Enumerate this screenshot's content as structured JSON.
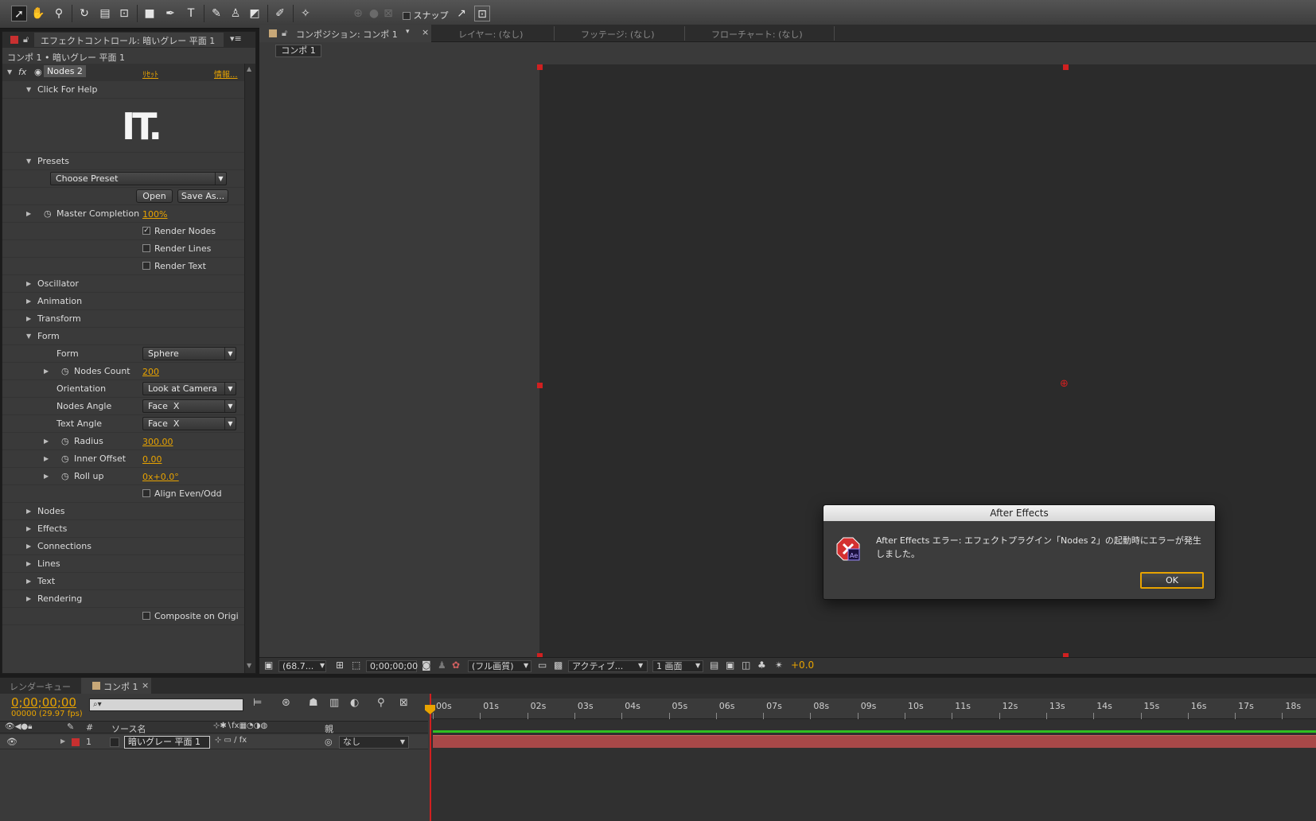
{
  "toolbar": {
    "snap_label": "スナップ"
  },
  "effect_panel": {
    "tab_label": "エフェクトコントロール: 暗いグレー 平面 1",
    "breadcrumb": "コンポ 1 • 暗いグレー 平面 1",
    "effect_name": "Nodes 2",
    "reset_label": "ﾘｾｯﾄ",
    "about_label": "情報...",
    "help_label": "Click For Help",
    "logo_text": "IT.",
    "presets_label": "Presets",
    "preset_dropdown": "Choose Preset",
    "open_button": "Open",
    "save_as_button": "Save As...",
    "master_completion_label": "Master Completion",
    "master_completion_value": "100%",
    "render_nodes": {
      "label": "Render Nodes",
      "checked": true
    },
    "render_lines": {
      "label": "Render Lines",
      "checked": false
    },
    "render_text": {
      "label": "Render Text",
      "checked": false
    },
    "oscillator": "Oscillator",
    "animation": "Animation",
    "transform": "Transform",
    "form_group": "Form",
    "form_label": "Form",
    "form_value": "Sphere",
    "nodes_count_label": "Nodes Count",
    "nodes_count_value": "200",
    "orientation_label": "Orientation",
    "orientation_value": "Look at Camera",
    "nodes_angle_label": "Nodes Angle",
    "nodes_angle_value": "Face  X",
    "text_angle_label": "Text Angle",
    "text_angle_value": "Face  X",
    "radius_label": "Radius",
    "radius_value": "300.00",
    "inner_offset_label": "Inner Offset",
    "inner_offset_value": "0.00",
    "roll_up_label": "Roll up",
    "roll_up_value": "0x+0.0°",
    "align_label": "Align Even/Odd",
    "nodes": "Nodes",
    "effects": "Effects",
    "connections": "Connections",
    "lines": "Lines",
    "text": "Text",
    "rendering": "Rendering",
    "composite_label": "Composite on Origi"
  },
  "comp_panel": {
    "tabs": [
      {
        "label": "コンポジション: コンポ 1"
      },
      {
        "label": "レイヤー: (なし)"
      },
      {
        "label": "フッテージ: (なし)"
      },
      {
        "label": "フローチャート: (なし)"
      }
    ],
    "sub_tab": "コンポ 1",
    "footer": {
      "zoom": "(68.7...",
      "timecode": "0;00;00;00",
      "resolution": "(フル画質)",
      "camera": "アクティブ...",
      "views": "1 画面",
      "exposure": "+0.0"
    }
  },
  "timeline": {
    "tab_render_queue": "レンダーキュー",
    "tab_comp": "コンポ 1",
    "timecode": "0;00;00;00",
    "frames": "00000 (29.97 fps)",
    "search_placeholder": "⌕▾",
    "col_hash": "#",
    "col_source": "ソース名",
    "col_parent": "親",
    "layer_number": "1",
    "layer_name": "暗いグレー 平面 1",
    "layer_parent": "なし",
    "ruler_labels": [
      "00s",
      "01s",
      "02s",
      "03s",
      "04s",
      "05s",
      "06s",
      "07s",
      "08s",
      "09s",
      "10s",
      "11s",
      "12s",
      "13s",
      "14s",
      "15s",
      "16s",
      "17s",
      "18s"
    ]
  },
  "dialog": {
    "title": "After Effects",
    "message": "After Effects エラー: エフェクトプラグイン「Nodes 2」の起動時にエラーが発生しました。",
    "ok_button": "OK"
  },
  "colors": {
    "accent": "#e8a300",
    "handle": "#d02020",
    "layer_bar": "#a84848"
  }
}
